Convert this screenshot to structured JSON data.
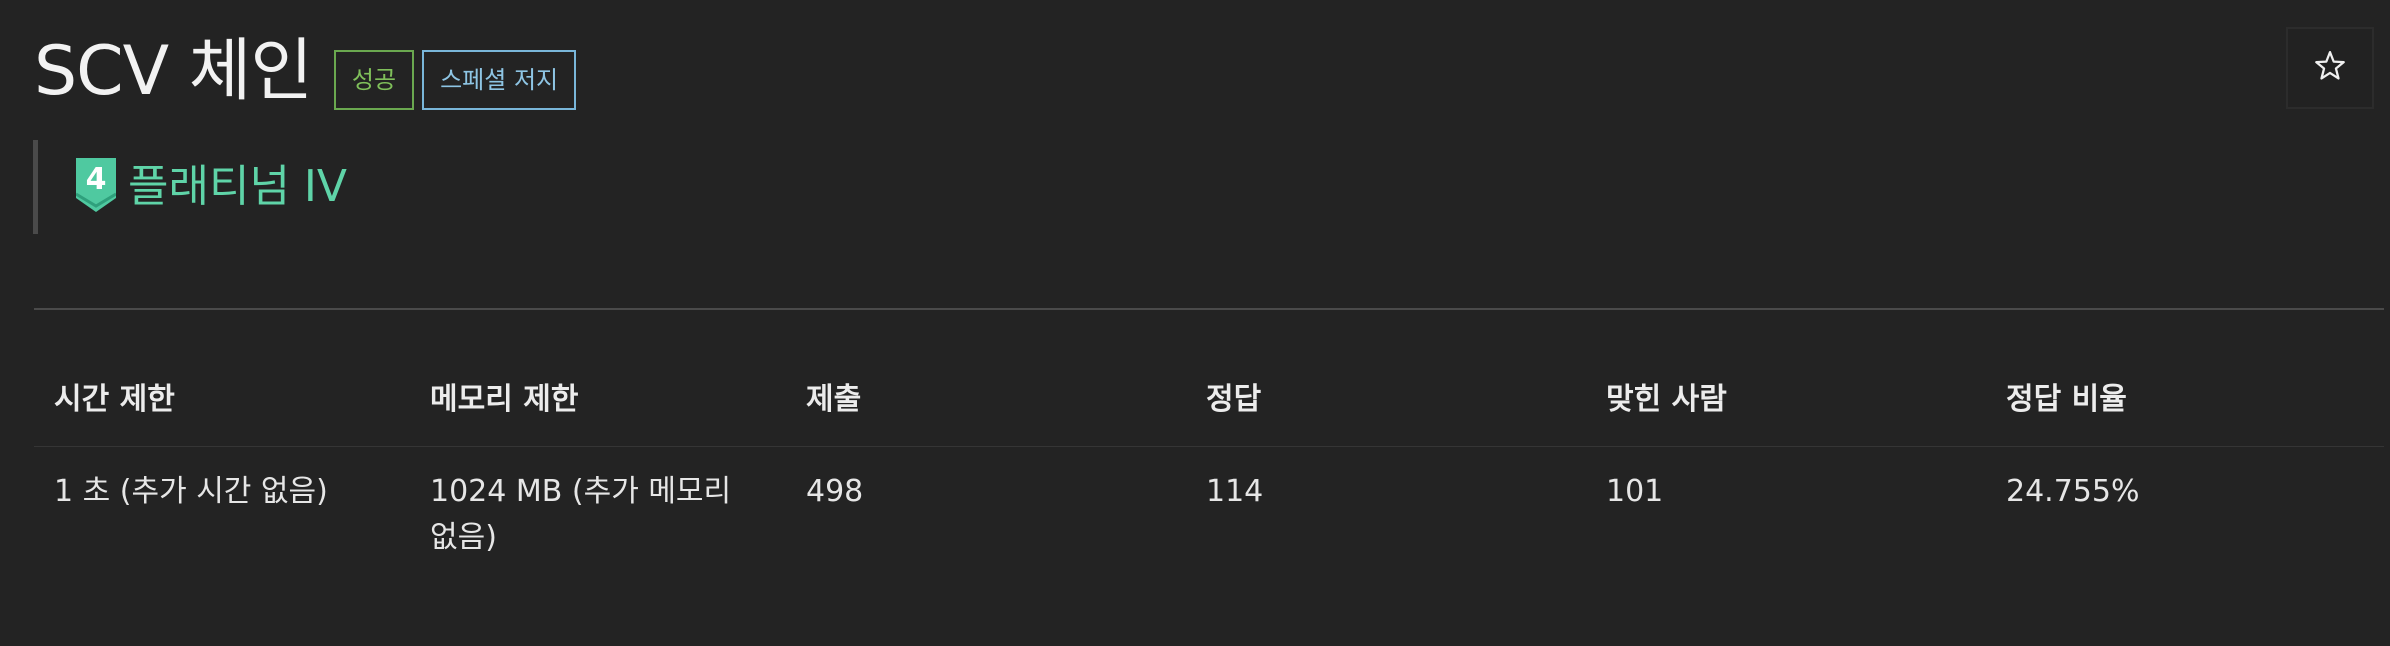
{
  "problem": {
    "title": "SCV 체인",
    "labels": {
      "success": "성공",
      "special_judge": "스페셜 저지"
    },
    "tier": {
      "level_number": "4",
      "name": "플래티넘 IV",
      "color": "#5fd4a8"
    },
    "favorite_icon": "star-outline-icon"
  },
  "stats_table": {
    "headers": [
      "시간 제한",
      "메모리 제한",
      "제출",
      "정답",
      "맞힌 사람",
      "정답 비율"
    ],
    "rows": [
      [
        "1 초 (추가 시간 없음)",
        "1024 MB (추가 메모리 없음)",
        "498",
        "114",
        "101",
        "24.755%"
      ]
    ]
  },
  "colors": {
    "background": "#232323",
    "success_green": "#6aa84f",
    "special_blue": "#79b6d9"
  }
}
